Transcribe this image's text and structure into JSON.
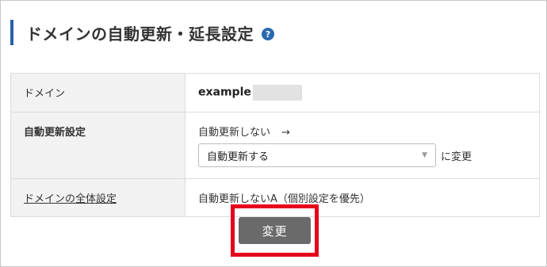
{
  "page": {
    "title": "ドメインの自動更新・延長設定",
    "help_icon": "?"
  },
  "table": {
    "rows": [
      {
        "label": "ドメイン",
        "value": "example"
      },
      {
        "label": "自動更新設定",
        "current": "自動更新しない",
        "arrow": "→",
        "select_value": "自動更新する",
        "after_select": "に変更"
      },
      {
        "label": "ドメインの全体設定",
        "value": "自動更新しないA（個別設定を優先）"
      }
    ]
  },
  "actions": {
    "submit_label": "変更"
  },
  "colors": {
    "accent_bar": "#2a5fa8",
    "highlight_border": "#e5001c",
    "button_bg": "#6a6a6a"
  },
  "icons": {
    "help": "question-circle-icon",
    "select_caret": "caret-down-icon"
  }
}
